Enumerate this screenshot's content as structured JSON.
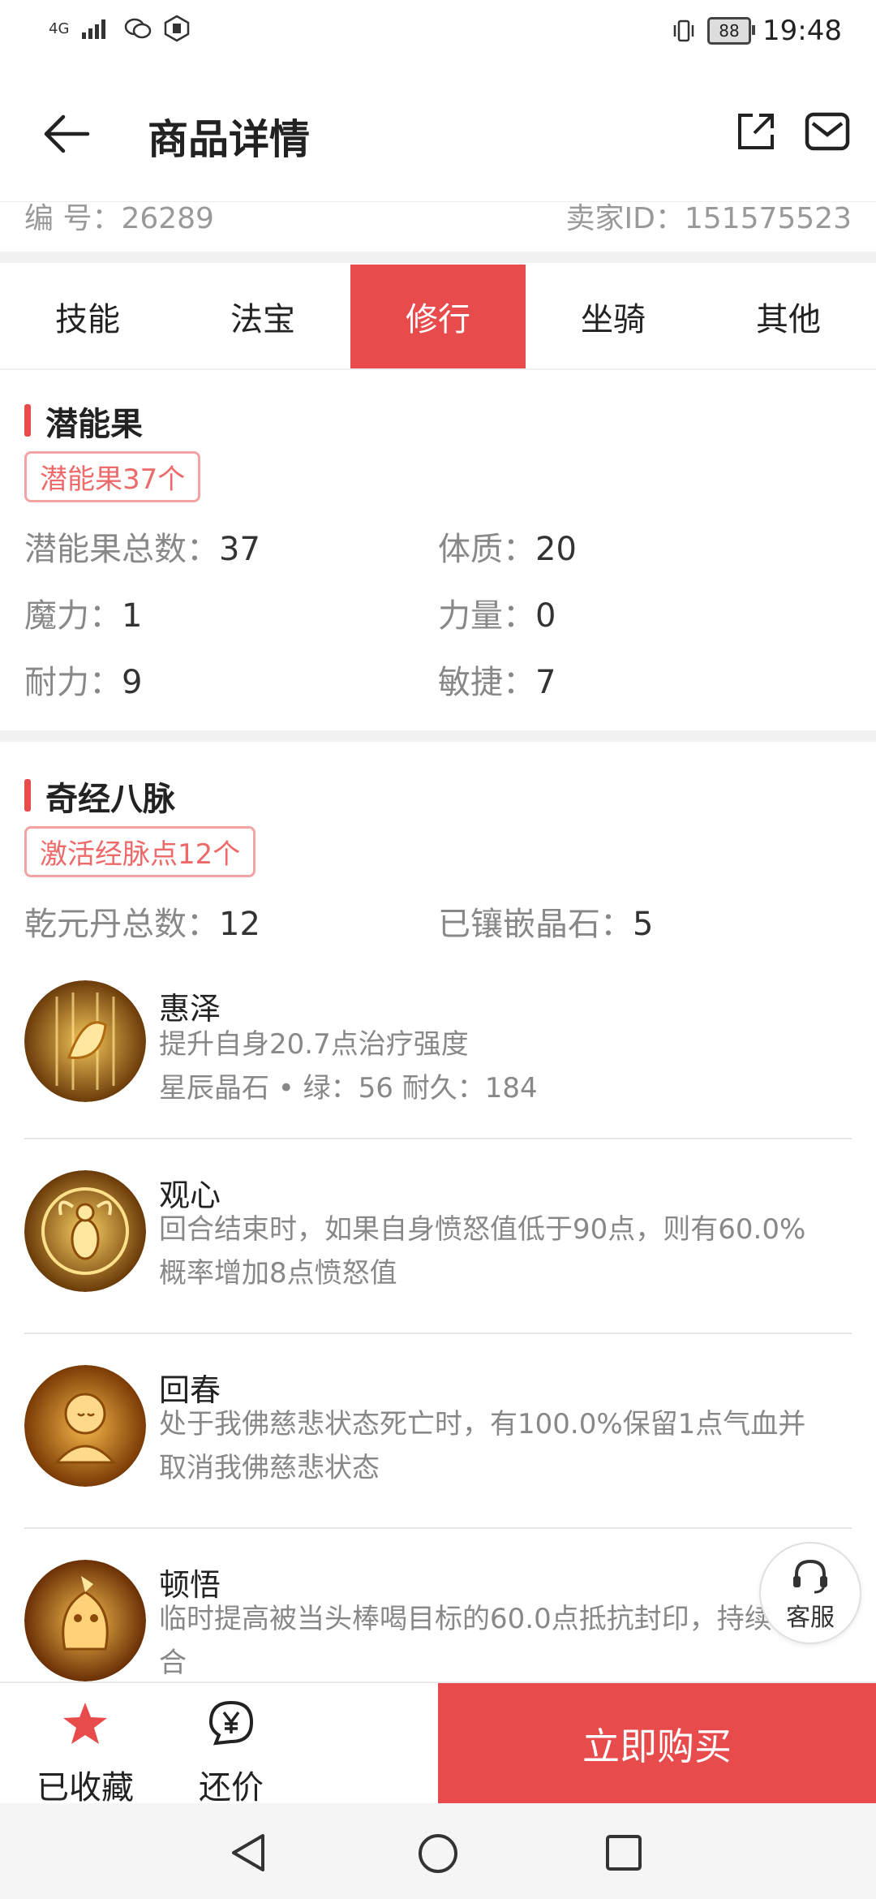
{
  "statusbar": {
    "network": "4G",
    "battery": "88",
    "time": "19:48"
  },
  "appbar": {
    "title": "商品详情"
  },
  "trunc": {
    "left": "编  号：26289",
    "right": "卖家ID：151575523"
  },
  "tabs": [
    {
      "label": "技能",
      "active": false
    },
    {
      "label": "法宝",
      "active": false
    },
    {
      "label": "修行",
      "active": true
    },
    {
      "label": "坐骑",
      "active": false
    },
    {
      "label": "其他",
      "active": false
    }
  ],
  "potential": {
    "title": "潜能果",
    "tag": "潜能果37个",
    "items": [
      {
        "k": "潜能果总数：",
        "v": "37"
      },
      {
        "k": "体质：",
        "v": "20"
      },
      {
        "k": "魔力：",
        "v": "1"
      },
      {
        "k": "力量：",
        "v": "0"
      },
      {
        "k": "耐力：",
        "v": "9"
      },
      {
        "k": "敏捷：",
        "v": "7"
      }
    ]
  },
  "meridian": {
    "title": "奇经八脉",
    "tag": "激活经脉点12个",
    "items": [
      {
        "k": "乾元丹总数：",
        "v": "12"
      },
      {
        "k": "已镶嵌晶石：",
        "v": "5"
      }
    ],
    "skills": [
      {
        "name": "惠泽",
        "desc1": "提升自身20.7点治疗强度",
        "desc2": "星辰晶石 • 绿：56   耐久：184"
      },
      {
        "name": "观心",
        "desc1": "回合结束时，如果自身愤怒值低于90点，则有60.0%",
        "desc2": "概率增加8点愤怒值"
      },
      {
        "name": "回春",
        "desc1": "处于我佛慈悲状态死亡时，有100.0%保留1点气血并",
        "desc2": "取消我佛慈悲状态"
      },
      {
        "name": "顿悟",
        "desc1": "临时提高被当头棒喝目标的60.0点抵抗封印，持续",
        "desc2": "合"
      }
    ]
  },
  "service": {
    "label": "客服"
  },
  "bottombar": {
    "fav_label": "已收藏",
    "bargain_label": "还价",
    "buy_label": "立即购买"
  },
  "colors": {
    "accent": "#e84b4b",
    "tag_border": "#f3a3a3",
    "tag_text": "#ee6a6a"
  }
}
